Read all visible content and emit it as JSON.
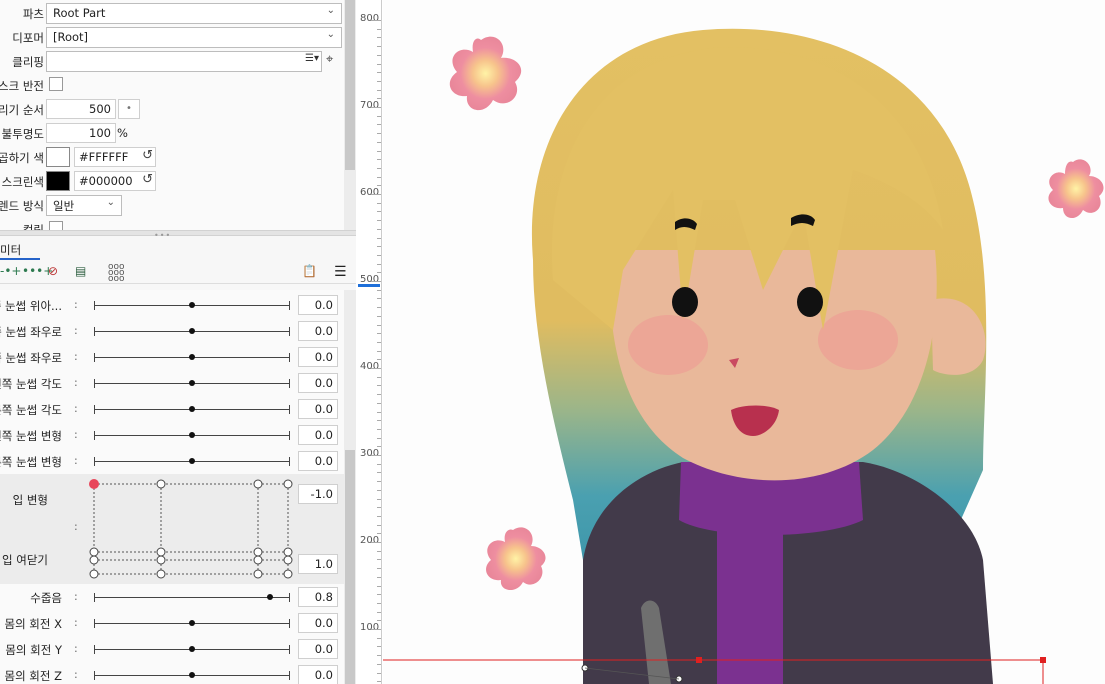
{
  "properties": {
    "parts_label": "파츠",
    "parts_value": "Root Part",
    "deformer_label": "디포머",
    "deformer_value": "[Root]",
    "clipping_label": "클리핑",
    "mask_invert_label": "스크 반전",
    "draw_order_label": "리기 순서",
    "draw_order_value": "500",
    "draw_order_btn": "•",
    "opacity_label": "불투명도",
    "opacity_value": "100",
    "opacity_unit": "%",
    "multiply_color_label": "곱하기 색",
    "multiply_color_hex": "#FFFFFF",
    "screen_color_label": "스크린색",
    "screen_color_hex": "#000000",
    "blend_mode_label": "렌드 방식",
    "blend_mode_value": "일반",
    "culling_label": "컬링"
  },
  "colors": {
    "multiply_color": "#FFFFFF",
    "screen_color": "#000000",
    "accent": "#1e6fd9",
    "selection_line": "#e02020"
  },
  "parameters_panel": {
    "tab_label": "미터",
    "rows": [
      {
        "label": "른쪽 눈썹 위아...",
        "value": "0.0",
        "knob": 0.5
      },
      {
        "label": "쪽 눈썹 좌우로",
        "value": "0.0",
        "knob": 0.5
      },
      {
        "label": "른쪽 눈썹 좌우로",
        "value": "0.0",
        "knob": 0.5
      },
      {
        "label": "왼쪽 눈썹 각도",
        "value": "0.0",
        "knob": 0.5
      },
      {
        "label": "른쪽 눈썹 각도",
        "value": "0.0",
        "knob": 0.5
      },
      {
        "label": "왼쪽 눈썹 변형",
        "value": "0.0",
        "knob": 0.5
      },
      {
        "label": "른쪽 눈썹 변형",
        "value": "0.0",
        "knob": 0.5
      }
    ],
    "mouth_form": {
      "label": "입 변형",
      "value": "-1.0"
    },
    "mouth_open": {
      "label": "입 여닫기",
      "value": "1.0"
    },
    "rows_bottom": [
      {
        "label": "수줍음",
        "value": "0.8",
        "knob": 0.9
      },
      {
        "label": "몸의 회전 X",
        "value": "0.0",
        "knob": 0.5
      },
      {
        "label": "몸의 회전  Y",
        "value": "0.0",
        "knob": 0.5
      },
      {
        "label": "몸의 회전 Z",
        "value": "0.0",
        "knob": 0.5
      }
    ]
  },
  "ruler": {
    "labels": [
      "800",
      "700",
      "600",
      "500",
      "400",
      "300",
      "200",
      "100"
    ]
  }
}
